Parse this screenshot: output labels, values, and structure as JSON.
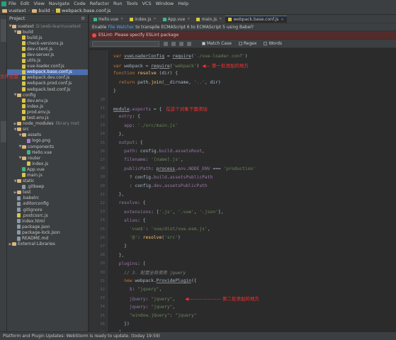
{
  "menubar": {
    "items": [
      "File",
      "Edit",
      "View",
      "Navigate",
      "Code",
      "Refactor",
      "Run",
      "Tools",
      "VCS",
      "Window",
      "Help"
    ]
  },
  "breadcrumb": [
    "vuetext",
    "build",
    "webpack.base.conf.js"
  ],
  "project_panel": {
    "title": "Project",
    "root": "vuetext",
    "root_path": "D:\\web-learn\\vuetext",
    "tree": [
      {
        "label": "vuetext",
        "note": "D:\\web-learn\\vuetext",
        "type": "folder",
        "depth": 0,
        "open": true
      },
      {
        "label": "build",
        "type": "folder",
        "depth": 1,
        "open": true
      },
      {
        "label": "build.js",
        "type": "js",
        "depth": 2
      },
      {
        "label": "check-versions.js",
        "type": "js",
        "depth": 2
      },
      {
        "label": "dev-client.js",
        "type": "js",
        "depth": 2
      },
      {
        "label": "dev-server.js",
        "type": "js",
        "depth": 2
      },
      {
        "label": "utils.js",
        "type": "js",
        "depth": 2
      },
      {
        "label": "vue-loader.conf.js",
        "type": "js",
        "depth": 2
      },
      {
        "label": "webpack.base.conf.js",
        "type": "js",
        "depth": 2,
        "selected": true
      },
      {
        "label": "webpack.dev.conf.js",
        "type": "js",
        "depth": 2
      },
      {
        "label": "webpack.prod.conf.js",
        "type": "js",
        "depth": 2
      },
      {
        "label": "webpack.test.conf.js",
        "type": "js",
        "depth": 2
      },
      {
        "label": "config",
        "type": "folder",
        "depth": 1,
        "open": true
      },
      {
        "label": "dev.env.js",
        "type": "js",
        "depth": 2
      },
      {
        "label": "index.js",
        "type": "js",
        "depth": 2
      },
      {
        "label": "prod.env.js",
        "type": "js",
        "depth": 2
      },
      {
        "label": "test.env.js",
        "type": "js",
        "depth": 2
      },
      {
        "label": "node_modules",
        "note": "library root",
        "type": "folder",
        "depth": 1,
        "open": false
      },
      {
        "label": "src",
        "type": "folder",
        "depth": 1,
        "open": true
      },
      {
        "label": "assets",
        "type": "folder",
        "depth": 2,
        "open": true
      },
      {
        "label": "logo.png",
        "type": "img",
        "depth": 3
      },
      {
        "label": "components",
        "type": "folder",
        "depth": 2,
        "open": true
      },
      {
        "label": "Hello.vue",
        "type": "vue",
        "depth": 3
      },
      {
        "label": "router",
        "type": "folder",
        "depth": 2,
        "open": true
      },
      {
        "label": "index.js",
        "type": "js",
        "depth": 3
      },
      {
        "label": "App.vue",
        "type": "vue",
        "depth": 2
      },
      {
        "label": "main.js",
        "type": "js",
        "depth": 2
      },
      {
        "label": "static",
        "type": "folder",
        "depth": 1,
        "open": true
      },
      {
        "label": ".gitkeep",
        "type": "txt",
        "depth": 2
      },
      {
        "label": "test",
        "type": "folder",
        "depth": 1,
        "open": false
      },
      {
        "label": ".babelrc",
        "type": "txt",
        "depth": 1
      },
      {
        "label": ".editorconfig",
        "type": "txt",
        "depth": 1
      },
      {
        "label": ".gitignore",
        "type": "txt",
        "depth": 1
      },
      {
        "label": ".postcssrc.js",
        "type": "js",
        "depth": 1
      },
      {
        "label": "index.html",
        "type": "txt",
        "depth": 1
      },
      {
        "label": "package.json",
        "type": "txt",
        "depth": 1
      },
      {
        "label": "package-lock.json",
        "type": "txt",
        "depth": 1
      },
      {
        "label": "README.md",
        "type": "txt",
        "depth": 1
      },
      {
        "label": "External Libraries",
        "type": "folder",
        "depth": 0,
        "open": false
      }
    ]
  },
  "side_annotation": "文件位置",
  "tabs": [
    {
      "label": "Hello.vue",
      "color": "#41b883",
      "active": false
    },
    {
      "label": "index.js",
      "color": "#d8c64a",
      "active": false
    },
    {
      "label": "App.vue",
      "color": "#41b883",
      "active": false
    },
    {
      "label": "main.js",
      "color": "#d8c64a",
      "active": false
    },
    {
      "label": "webpack.base.conf.js",
      "color": "#d8c64a",
      "active": true
    }
  ],
  "notices": {
    "watcher_pre": "Enable",
    "watcher_link": "File Watcher",
    "watcher_post": "to transpile ECMAScript 6 to ECMAScript 5 using Babel?",
    "eslint": "ESLint: Please specify ESLint package"
  },
  "search": {
    "match_case": "Match Case",
    "regex": "Regex",
    "words": "Words"
  },
  "code": {
    "annotation1": "第一处添加的地方",
    "annotation2": "在这个对象下面添加",
    "annotation3": "第二处添加的地方",
    "lines": [
      {
        "n": "",
        "html": "<span class=\"kw\">var</span> <span class=\"und\">vueLoaderConfig</span> = <span class=\"und\">require</span>(<span class=\"str\">'./vue-loader.conf'</span>)"
      },
      {
        "n": "",
        "html": "<span class=\"kw\">var</span> webpack = <span class=\"und\">require</span>(<span class=\"str\">'webpack'</span>)"
      },
      {
        "n": "",
        "html": "<span class=\"kw\">function</span> <span class=\"fn\">resolve</span> (dir) {"
      },
      {
        "n": "",
        "html": "  <span class=\"kw\">return</span> path.<span class=\"fn\">join</span>(__dirname, <span class=\"str\">'..'</span>, dir)"
      },
      {
        "n": "",
        "html": "}"
      },
      {
        "n": "10",
        "html": ""
      },
      {
        "n": "11",
        "html": "<span class=\"und\">module</span>.<span class=\"prop\">exports</span> = {"
      },
      {
        "n": "12",
        "html": "  <span class=\"prop\">entry</span>: {"
      },
      {
        "n": "13",
        "html": "    <span class=\"prop\">app</span>: <span class=\"str\">'./src/main.js'</span>"
      },
      {
        "n": "14",
        "html": "  },"
      },
      {
        "n": "15",
        "html": "  <span class=\"prop\">output</span>: {"
      },
      {
        "n": "16",
        "html": "    <span class=\"prop\">path</span>: config.<span class=\"prop\">build</span>.<span class=\"prop\">assetsRoot</span>,"
      },
      {
        "n": "17",
        "html": "    <span class=\"prop\">filename</span>: <span class=\"str\">'[name].js'</span>,"
      },
      {
        "n": "18",
        "html": "    <span class=\"prop\">publicPath</span>: <span class=\"und\">process</span>.<span class=\"prop\">env</span>.<span class=\"prop\">NODE_ENV</span> === <span class=\"str\">'production'</span>"
      },
      {
        "n": "19",
        "html": "      ? config.<span class=\"prop\">build</span>.<span class=\"prop\">assetsPublicPath</span>"
      },
      {
        "n": "20",
        "html": "      : config.<span class=\"prop\">dev</span>.<span class=\"prop\">assetsPublicPath</span>"
      },
      {
        "n": "21",
        "html": "  },"
      },
      {
        "n": "22",
        "html": "  <span class=\"prop\">resolve</span>: {"
      },
      {
        "n": "23",
        "html": "    <span class=\"prop\">extensions</span>: [<span class=\"str\">'.js'</span>, <span class=\"str\">'.vue'</span>, <span class=\"str\">'.json'</span>],"
      },
      {
        "n": "24",
        "html": "    <span class=\"prop\">alias</span>: {"
      },
      {
        "n": "25",
        "html": "      <span class=\"str\">'vue$'</span>: <span class=\"str\">'vue/dist/vue.esm.js'</span>,"
      },
      {
        "n": "26",
        "html": "      <span class=\"str\">'@'</span>: <span class=\"fn\">resolve</span>(<span class=\"str\">'src'</span>)"
      },
      {
        "n": "27",
        "html": "    }"
      },
      {
        "n": "28",
        "html": "  },"
      },
      {
        "n": "29",
        "html": "  <span class=\"prop\">plugins</span>: ["
      },
      {
        "n": "30",
        "html": "    <span class=\"cm\">// 3. 配置全局使用 jquery</span>"
      },
      {
        "n": "31",
        "html": "    <span class=\"kw\">new</span> webpack.<span class=\"und\">ProvidePlugin</span>({"
      },
      {
        "n": "32",
        "html": "      <span class=\"prop\">$</span>: <span class=\"str\">\"jquery\"</span>,"
      },
      {
        "n": "33",
        "html": "      <span class=\"prop\">jQuery</span>: <span class=\"str\">\"jquery\"</span>,"
      },
      {
        "n": "34",
        "html": "      <span class=\"prop\">jquery</span>: <span class=\"str\">\"jquery\"</span>,"
      },
      {
        "n": "35",
        "html": "      <span class=\"str\">\"window.jQuery\"</span>: <span class=\"str\">\"jquery\"</span>"
      },
      {
        "n": "36",
        "html": "    })"
      },
      {
        "n": "37",
        "html": "  ],"
      }
    ]
  },
  "status": "Platform and Plugin Updates: WebStorm is ready to update. (today 19:59)"
}
